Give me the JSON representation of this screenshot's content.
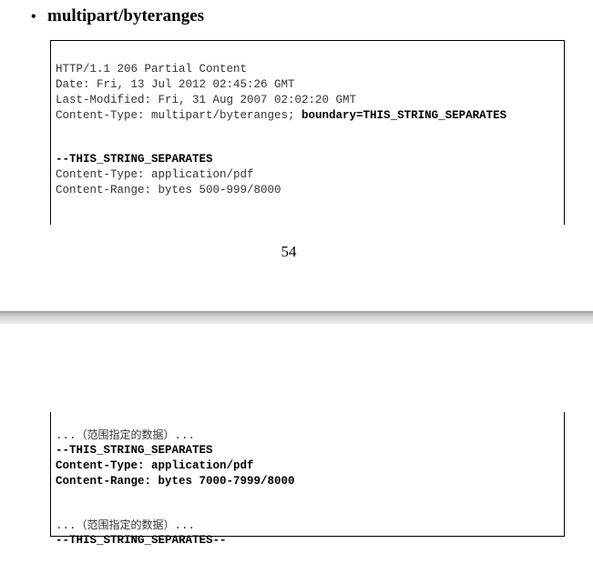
{
  "heading": {
    "bullet": "•",
    "text": "multipart/byteranges"
  },
  "block1": {
    "lines": [
      "HTTP/1.1 206 Partial Content",
      "Date: Fri, 13 Jul 2012 02:45:26 GMT",
      "Last-Modified: Fri, 31 Aug 2007 02:02:20 GMT"
    ],
    "content_type_prefix": "Content-Type: multipart/byteranges; ",
    "content_type_boundary": "boundary=THIS_STRING_SEPARATES",
    "separator": "--THIS_STRING_SEPARATES",
    "part_lines": [
      "Content-Type: application/pdf",
      "Content-Range: bytes 500-999/8000"
    ]
  },
  "page_number": "54",
  "block2": {
    "data_line_1_prefix": "...",
    "data_line_1_cjk": "（范围指定的数据）",
    "data_line_1_suffix": "...",
    "separator": "--THIS_STRING_SEPARATES",
    "content_type": "Content-Type: application/pdf",
    "content_range": "Content-Range: bytes 7000-7999/8000",
    "data_line_2_prefix": "...",
    "data_line_2_cjk": "（范围指定的数据）",
    "data_line_2_suffix": "...",
    "final_separator": "--THIS_STRING_SEPARATES--"
  }
}
